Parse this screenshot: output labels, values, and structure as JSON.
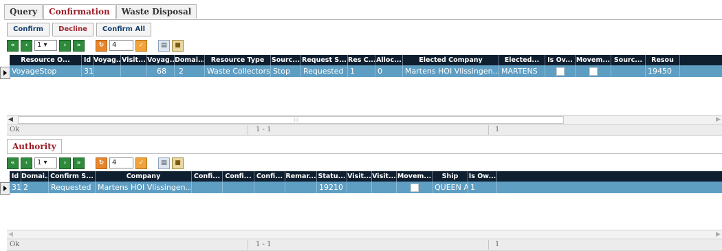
{
  "tabs": [
    "Query",
    "Confirmation",
    "Waste Disposal"
  ],
  "actions": {
    "confirm": "Confirm",
    "decline": "Decline",
    "confirm_all": "Confirm All"
  },
  "pager": {
    "page": "1",
    "page_size": "4"
  },
  "top_grid": {
    "columns": [
      "Resource O...",
      "Id",
      "Voyag...",
      "Visit...",
      "Voyag...",
      "Domai...",
      "Resource Type",
      "Sourc...",
      "Request S...",
      "Res C...",
      "Alloc...",
      "Elected Company",
      "Elected...",
      "Is Ov...",
      "Movem...",
      "Sourc...",
      "Resou"
    ],
    "row": [
      "VoyageStop",
      "31",
      "",
      "",
      "68",
      "2",
      "Waste Collectors",
      "Stop",
      "Requested",
      "1",
      "0",
      "Martens HOI Vlissingen...",
      "MARTENS",
      "",
      "",
      "",
      "19450"
    ]
  },
  "top_status": {
    "text": "Ok",
    "range": "1 - 1",
    "count": "1"
  },
  "auth_tab": "Authority",
  "bottom_grid": {
    "columns": [
      "Id",
      "Domai...",
      "Confirm S...",
      "Company",
      "Confi...",
      "Confi...",
      "Confi...",
      "Remar...",
      "Statu...",
      "Visit...",
      "Visit...",
      "Movem...",
      "Ship",
      "Is Ow..."
    ],
    "row": [
      "31",
      "2",
      "Requested",
      "Martens HOI Vlissingen...",
      "",
      "",
      "",
      "",
      "19210",
      "",
      "",
      "",
      "QUEEN A",
      "1"
    ]
  },
  "bottom_status": {
    "text": "Ok",
    "range": "1 - 1",
    "count": "1"
  },
  "colors": {
    "header_bg": "#0f1f30",
    "row_selected": "#5f9ec3",
    "active_tab_text": "#9b1c24"
  }
}
